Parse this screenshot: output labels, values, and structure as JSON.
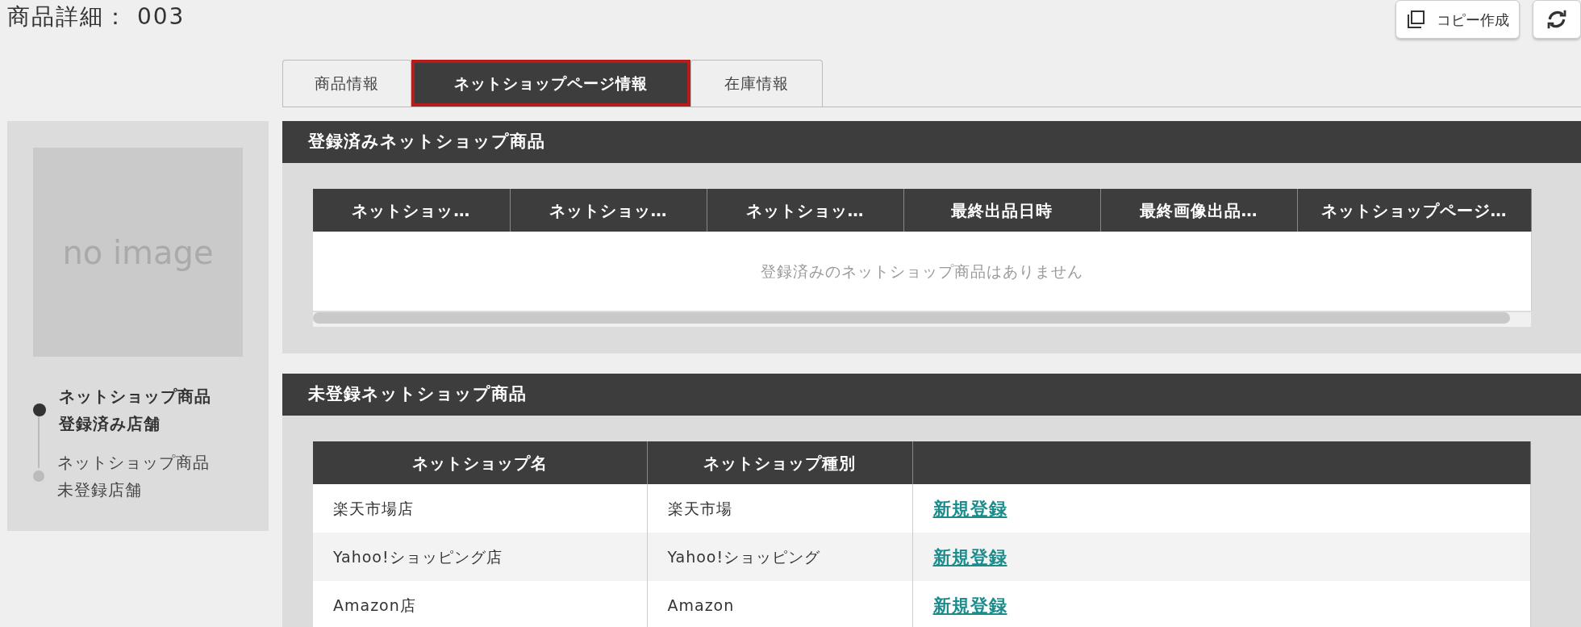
{
  "page_title": "商品詳細： 003",
  "toolbar": [
    {
      "kind": "copy",
      "label": "コピー作成"
    },
    {
      "kind": "refresh"
    }
  ],
  "tabs": [
    {
      "label": "商品情報",
      "selected": false
    },
    {
      "label": "ネットショップページ情報",
      "selected": true
    },
    {
      "label": "在庫情報",
      "selected": false
    }
  ],
  "sidebar": {
    "image_placeholder": "no image",
    "items": [
      {
        "label": "ネットショップ商品登録済み店舗",
        "selected": true
      },
      {
        "label": "ネットショップ商品未登録店舗",
        "selected": false
      }
    ]
  },
  "registered_section": {
    "title": "登録済みネットショップ商品",
    "columns": [
      "ネットショッ…",
      "ネットショッ…",
      "ネットショッ…",
      "最終出品日時",
      "最終画像出品…",
      "ネットショップページ…"
    ],
    "empty_message": "登録済みのネットショップ商品はありません"
  },
  "unregistered_section": {
    "title": "未登録ネットショップ商品",
    "columns": [
      "ネットショップ名",
      "ネットショップ種別"
    ],
    "rows": [
      {
        "shop_name": "楽天市場店",
        "shop_type": "楽天市場",
        "action": "新規登録"
      },
      {
        "shop_name": "Yahoo!ショッピング店",
        "shop_type": "Yahoo!ショッピング",
        "action": "新規登録"
      },
      {
        "shop_name": "Amazon店",
        "shop_type": "Amazon",
        "action": "新規登録"
      }
    ]
  }
}
